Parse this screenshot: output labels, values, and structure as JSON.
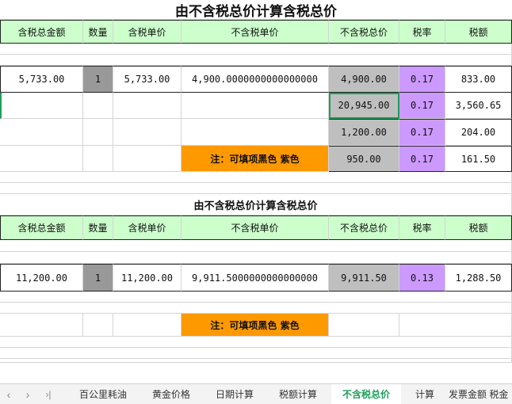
{
  "sheet": {
    "title1": "由不含税总价计算含税总价",
    "title2": "由不含税总价计算含税总价",
    "headers": [
      "含税总金额",
      "数量",
      "含税单价",
      "不含税单价",
      "不含税总价",
      "税率",
      "税额"
    ],
    "table1": {
      "row1": [
        "5,733.00",
        "1",
        "5,733.00",
        "4,900.0000000000000000",
        "4,900.00",
        "0.17",
        "833.00"
      ],
      "row2": [
        "20,945.00",
        "0.17",
        "3,560.65"
      ],
      "row3": [
        "1,200.00",
        "0.17",
        "204.00"
      ],
      "row4": [
        "950.00",
        "0.17",
        "161.50"
      ],
      "note": "注：可填项黑色  紫色"
    },
    "table2": {
      "row1": [
        "11,200.00",
        "1",
        "11,200.00",
        "9,911.5000000000000000",
        "9,911.50",
        "0.13",
        "1,288.50"
      ],
      "note": "注：可填项黑色  紫色"
    }
  },
  "tabbar": {
    "nav": [
      "‹",
      "›",
      "›|"
    ],
    "tabs": [
      "百公里耗油",
      "黄金价格",
      "日期计算",
      "税额计算",
      "不含税总价",
      "计算",
      "发票金额 税金"
    ],
    "active": 4
  },
  "colors": {
    "header_green": "#ccffcc",
    "gray": "#bfbfbf",
    "purple": "#cc99ff",
    "orange": "#ff9900",
    "active_tab": "#1f9e5c"
  }
}
